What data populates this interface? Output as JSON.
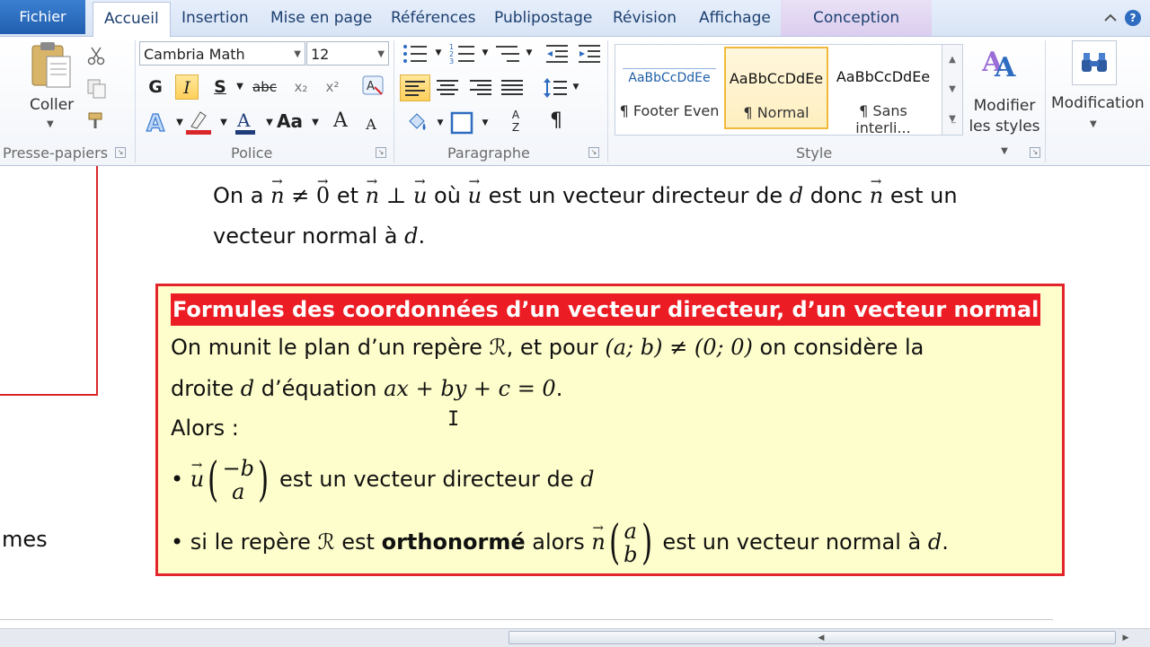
{
  "tabs": {
    "file": "Fichier",
    "items": [
      "Accueil",
      "Insertion",
      "Mise en page",
      "Références",
      "Publipostage",
      "Révision",
      "Affichage",
      "Conception"
    ],
    "active": "Accueil"
  },
  "clipboard": {
    "paste_label": "Coller",
    "group_label": "Presse-papiers"
  },
  "font": {
    "family": "Cambria Math",
    "size": "12",
    "group_label": "Police",
    "bold": "G",
    "italic": "I",
    "underline": "S",
    "strike": "abc",
    "subscript": "x₂",
    "superscript": "x²",
    "grow": "A",
    "shrink": "A",
    "case": "Aa"
  },
  "paragraph": {
    "group_label": "Paragraphe",
    "pilcrow": "¶",
    "sort": "AZ"
  },
  "styles": {
    "group_label": "Style",
    "items": [
      {
        "sample": "AaBbCcDdEe",
        "name": "¶ Footer Even"
      },
      {
        "sample": "AaBbCcDdEe",
        "name": "¶ Normal"
      },
      {
        "sample": "AaBbCcDdEe",
        "name": "¶ Sans interli..."
      }
    ],
    "selected": "¶ Normal",
    "modify_line1": "Modifier",
    "modify_line2": "les styles"
  },
  "editing": {
    "label": "Modification"
  },
  "document": {
    "line1_parts": [
      "On a ",
      "n",
      " ≠ ",
      "0",
      " et ",
      "n",
      " ⊥ ",
      "u",
      " où ",
      "u",
      " est un vecteur directeur de ",
      "d",
      " donc ",
      "n",
      " est un"
    ],
    "line2_parts": [
      "vecteur normal à ",
      "d",
      "."
    ],
    "cut_text": "mes",
    "box": {
      "title": "Formules des coordonnées d’un vecteur directeur, d’un vecteur normal",
      "l1_a": "On munit le plan d’un repère ",
      "l1_R": "ℛ",
      "l1_b": ", et pour ",
      "l1_math": "(a; b) ≠ (0; 0)",
      "l1_c": " on considère la",
      "l2_a": "droite ",
      "l2_d": "d",
      "l2_b": " d’équation ",
      "l2_math": "ax + by + c = 0",
      "l2_c": ".",
      "l3": "Alors :",
      "b1_bullet": "•",
      "b1_vec": "u",
      "b1_top": "−b",
      "b1_bot": "a",
      "b1_text": " est un vecteur directeur de ",
      "b1_d": "d",
      "b2_bullet": "•",
      "b2_a": " si le repère ",
      "b2_R": "ℛ",
      "b2_b": " est ",
      "b2_bold": "orthonormé",
      "b2_c": " alors ",
      "b2_vec": "n",
      "b2_top": "a",
      "b2_bot": "b",
      "b2_text": " est un vecteur normal à ",
      "b2_d": "d",
      "b2_end": "."
    }
  },
  "colors": {
    "accent": "#2d6cc0",
    "box_border": "#e2242b",
    "box_bg": "#fefecc",
    "title_bg": "#ec1c24"
  }
}
